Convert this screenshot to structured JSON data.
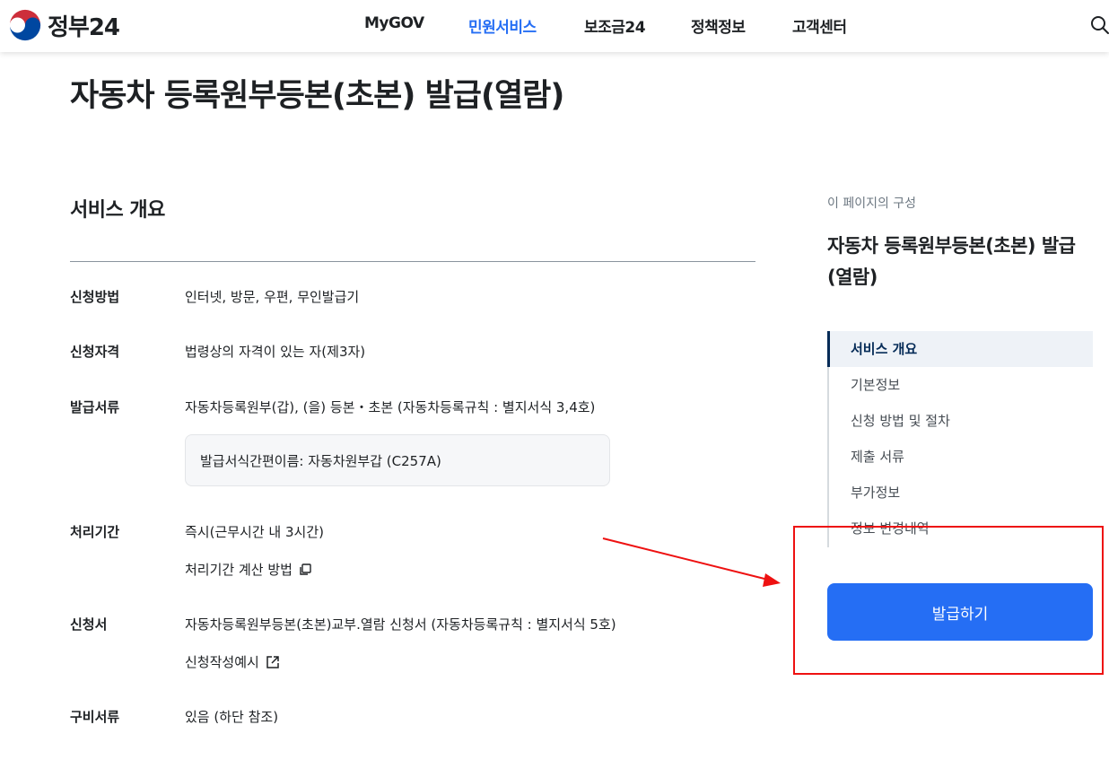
{
  "header": {
    "logo_text": "정부24",
    "nav": [
      "MyGOV",
      "민원서비스",
      "보조금24",
      "정책정보",
      "고객센터"
    ],
    "active_nav": "민원서비스"
  },
  "page": {
    "title": "자동차 등록원부등본(초본) 발급(열람)"
  },
  "overview": {
    "title": "서비스 개요",
    "rows": [
      {
        "label": "신청방법",
        "value": "인터넷, 방문, 우편, 무인발급기"
      },
      {
        "label": "신청자격",
        "value": "법령상의 자격이 있는 자(제3자)"
      },
      {
        "label": "발급서류",
        "value": "자동차등록원부(갑), (을) 등본・초본 (자동차등록규칙 : 별지서식 3,4호)",
        "note": "발급서식간편이름: 자동차원부갑 (C257A)"
      },
      {
        "label": "처리기간",
        "value": "즉시(근무시간 내 3시간)",
        "link": "처리기간 계산 방법"
      },
      {
        "label": "신청서",
        "value": "자동차등록원부등본(초본)교부.열람 신청서 (자동차등록규칙 : 별지서식 5호)",
        "link": "신청작성예시"
      },
      {
        "label": "구비서류",
        "value": "있음 (하단 참조)"
      }
    ]
  },
  "toc": {
    "caption": "이 페이지의 구성",
    "title": "자동차 등록원부등본(초본) 발급(열람)",
    "items": [
      "서비스 개요",
      "기본정보",
      "신청 방법 및 절차",
      "제출 서류",
      "부가정보",
      "정보 변경내역"
    ],
    "active_index": 0
  },
  "actions": {
    "issue_label": "발급하기"
  },
  "colors": {
    "primary": "#256ef4",
    "annotation": "#ee1111",
    "toc_active": "#052b57"
  }
}
